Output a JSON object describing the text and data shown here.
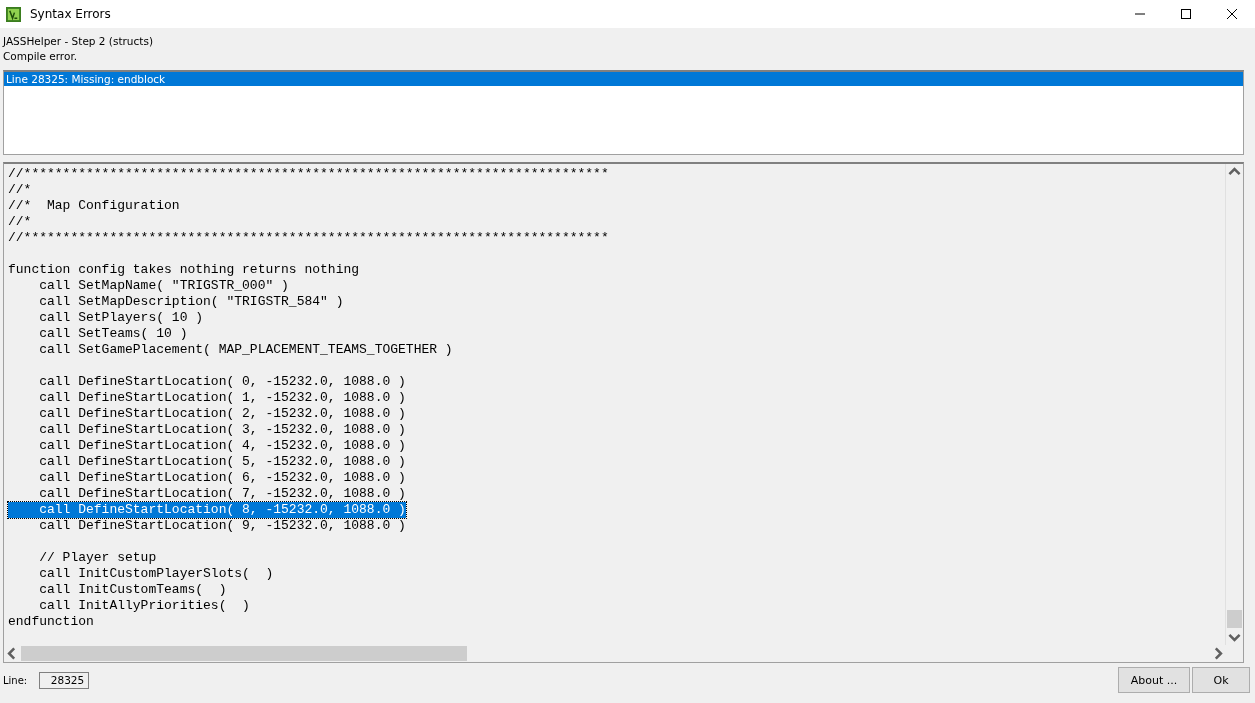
{
  "window": {
    "title": "Syntax Errors"
  },
  "step_label": "JASSHelper - Step 2 (structs)",
  "status_label": "Compile error.",
  "errors": [
    {
      "text": "Line 28325: Missing: endblock",
      "selected": true
    }
  ],
  "code_lines": [
    {
      "kind": "text",
      "text": "//***************************************************************************",
      "selected": false
    },
    {
      "kind": "text",
      "text": "//*",
      "selected": false
    },
    {
      "kind": "text",
      "text": "//*  Map Configuration",
      "selected": false
    },
    {
      "kind": "text",
      "text": "//*",
      "selected": false
    },
    {
      "kind": "text",
      "text": "//***************************************************************************",
      "selected": false
    },
    {
      "kind": "blank"
    },
    {
      "kind": "text",
      "text": "function config takes nothing returns nothing",
      "selected": false
    },
    {
      "kind": "text",
      "text": "    call SetMapName( \"TRIGSTR_000\" )",
      "selected": false
    },
    {
      "kind": "text",
      "text": "    call SetMapDescription( \"TRIGSTR_584\" )",
      "selected": false
    },
    {
      "kind": "text",
      "text": "    call SetPlayers( 10 )",
      "selected": false
    },
    {
      "kind": "text",
      "text": "    call SetTeams( 10 )",
      "selected": false
    },
    {
      "kind": "text",
      "text": "    call SetGamePlacement( MAP_PLACEMENT_TEAMS_TOGETHER )",
      "selected": false
    },
    {
      "kind": "blank"
    },
    {
      "kind": "text",
      "text": "    call DefineStartLocation( 0, -15232.0, 1088.0 )",
      "selected": false
    },
    {
      "kind": "text",
      "text": "    call DefineStartLocation( 1, -15232.0, 1088.0 )",
      "selected": false
    },
    {
      "kind": "text",
      "text": "    call DefineStartLocation( 2, -15232.0, 1088.0 )",
      "selected": false
    },
    {
      "kind": "text",
      "text": "    call DefineStartLocation( 3, -15232.0, 1088.0 )",
      "selected": false
    },
    {
      "kind": "text",
      "text": "    call DefineStartLocation( 4, -15232.0, 1088.0 )",
      "selected": false
    },
    {
      "kind": "text",
      "text": "    call DefineStartLocation( 5, -15232.0, 1088.0 )",
      "selected": false
    },
    {
      "kind": "text",
      "text": "    call DefineStartLocation( 6, -15232.0, 1088.0 )",
      "selected": false
    },
    {
      "kind": "text",
      "text": "    call DefineStartLocation( 7, -15232.0, 1088.0 )",
      "selected": false
    },
    {
      "kind": "text",
      "text": "    call DefineStartLocation( 8, -15232.0, 1088.0 )",
      "selected": true
    },
    {
      "kind": "text",
      "text": "    call DefineStartLocation( 9, -15232.0, 1088.0 )",
      "selected": false
    },
    {
      "kind": "blank"
    },
    {
      "kind": "text",
      "text": "    // Player setup",
      "selected": false
    },
    {
      "kind": "text",
      "text": "    call InitCustomPlayerSlots(  )",
      "selected": false
    },
    {
      "kind": "text",
      "text": "    call InitCustomTeams(  )",
      "selected": false
    },
    {
      "kind": "text",
      "text": "    call InitAllyPriorities(  )",
      "selected": false
    },
    {
      "kind": "text",
      "text": "endfunction",
      "selected": false
    }
  ],
  "footer": {
    "line_label": "Line:",
    "line_value": "28325",
    "buttons": [
      "About ...",
      "Ok"
    ]
  }
}
